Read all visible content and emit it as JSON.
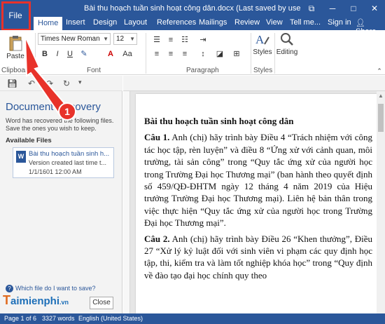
{
  "window": {
    "title": "Bài thu hoạch tuần sinh hoạt công dân.docx (Last saved by user) - Word",
    "restore_glyph": "⧉",
    "minimize_glyph": "─",
    "maximize_glyph": "□",
    "close_glyph": "✕"
  },
  "tabs": {
    "file": "File",
    "home": "Home",
    "insert": "Insert",
    "design": "Design",
    "layout": "Layout",
    "references": "References",
    "mailings": "Mailings",
    "review": "Review",
    "view": "View",
    "tell_me": "Tell me...",
    "sign_in": "Sign in",
    "share": "Share"
  },
  "ribbon": {
    "font_name": "Times New Roman",
    "font_size": "12",
    "paste_label": "Paste",
    "clipboard_label": "Clipboard",
    "font_group_label": "Font",
    "paragraph_group_label": "Paragraph",
    "styles_label": "Styles",
    "styles_group_label": "Styles",
    "editing_label": "Editing",
    "bold": "B",
    "italic": "I",
    "underline": "U"
  },
  "recovery": {
    "title": "Document Recovery",
    "description": "Word has recovered the following files. Save the ones you wish to keep.",
    "available_files": "Available Files",
    "file_name": "Bài thu hoạch tuần sinh h...",
    "file_version": "Version created last time t...",
    "file_date": "1/1/1601 12:00 AM",
    "which_file_link": "Which file do I want to save?",
    "close_button": "Close"
  },
  "document": {
    "heading": "Bài thu hoạch tuần sinh hoạt công dân",
    "q1_label": "Câu 1.",
    "q1_text": "Anh (chị) hãy trình bày Điều 4 “Trách nhiệm với công tác học tập, rèn luyện” và điều 8 “Ứng xử với cảnh quan, môi trường, tài sản công” trong “Quy tắc ứng xử của người học trong Trường Đại học Thương mại” (ban hành theo quyết định số 459/QĐ-ĐHTM ngày 12 tháng 4 năm 2019 của Hiệu trưởng Trường Đại học Thương mại). Liên hệ bản thân trong việc thực hiện “Quy tắc ứng xử của người học trong Trường Đại học Thương mại”.",
    "q2_label": "Câu 2.",
    "q2_text": "Anh (chị) hãy trình bày Điều 26 “Khen thưởng”, Điều 27 “Xử lý kỷ luật đối với sinh viên vi phạm các quy định học tập, thi, kiểm tra và làm tốt nghiệp khóa học” trong “Quy định về đào tạo đại học chính quy theo"
  },
  "statusbar": {
    "page": "Page 1 of 6",
    "words": "3327 words",
    "language": "English (United States)"
  },
  "watermark": {
    "t": "T",
    "rest": "aimienphi",
    "suffix": ".vn"
  },
  "annotation": {
    "step_number": "1"
  },
  "colors": {
    "word_blue": "#2b579a",
    "annotation_red": "#e8322a"
  }
}
